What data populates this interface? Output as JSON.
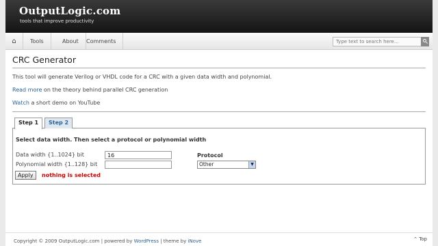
{
  "header": {
    "site_title": "OutputLogic.com",
    "tagline": "tools that improve productivity"
  },
  "nav": {
    "home_icon": "home-icon",
    "items": [
      {
        "label": "Tools"
      },
      {
        "label": "About"
      },
      {
        "label": "Comments"
      }
    ],
    "search_placeholder": "Type text to search here..."
  },
  "content": {
    "title": "CRC Generator",
    "description": "This tool will generate Verilog or VHDL code for a CRC with a given data width and polynomial.",
    "read_more_link": "Read more",
    "read_more_rest": " on the theory behind parallel CRC generation",
    "watch_link": "Watch",
    "watch_rest": " a short demo on YouTube"
  },
  "tabs": [
    {
      "label": "Step 1",
      "active": true
    },
    {
      "label": "Step 2",
      "active": false
    }
  ],
  "form": {
    "instructions": "Select data width. Then select a protocol or polynomial width",
    "data_width_label": "Data width {1..1024} bit",
    "data_width_value": "16",
    "poly_width_label": "Polynomial width {1..128} bit",
    "poly_width_value": "",
    "protocol_label": "Protocol",
    "protocol_selected": "Other",
    "apply_label": "Apply",
    "status": "nothing is selected"
  },
  "footer": {
    "copyright": "Copyright © 2009 OutputLogic.com | powered by ",
    "wordpress": "WordPress",
    "theme_by": " | theme by ",
    "inove": "iNove",
    "top_link": "Top"
  },
  "colors": {
    "link": "#2a6496",
    "status_error": "#cc0000",
    "header_bg": "#1f1f1f"
  }
}
